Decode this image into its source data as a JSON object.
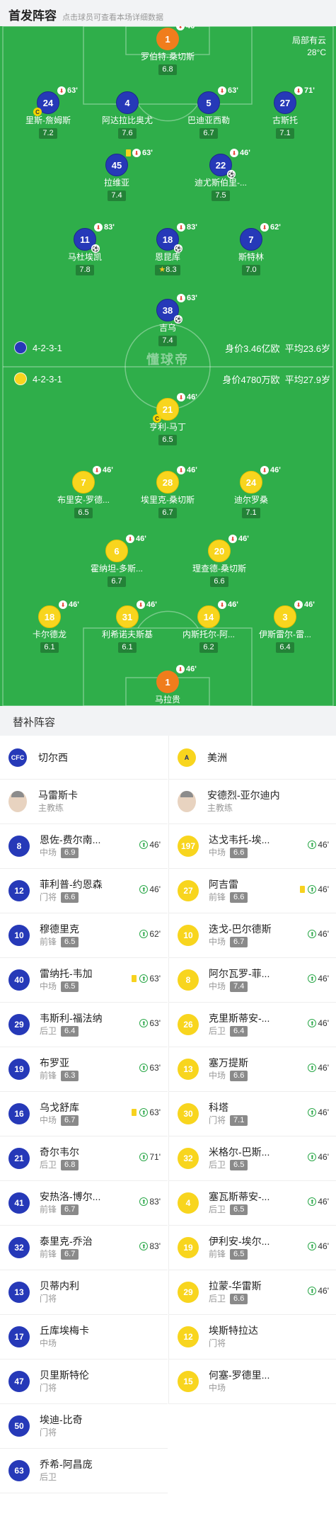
{
  "header": {
    "title": "首发阵容",
    "subtitle": "点击球员可查看本场详细数据"
  },
  "weather": {
    "condition": "局部有云",
    "temperature": "28°C"
  },
  "watermark": "懂球帝",
  "home_team": {
    "name": "切尔西",
    "formation": "4-2-3-1",
    "value": "身价3.46亿欧",
    "avg_age": "平均23.6岁",
    "color": "#2639b8"
  },
  "away_team": {
    "name": "美洲",
    "formation": "4-2-3-1",
    "value": "身价4780万欧",
    "avg_age": "平均27.9岁",
    "color": "#f8d51e"
  },
  "home_players": [
    {
      "num": "1",
      "name": "罗伯特-桑切斯",
      "rating": "6.8",
      "sub_min": "46'",
      "gk": true
    },
    {
      "num": "24",
      "name": "里斯-詹姆斯",
      "rating": "7.2",
      "sub_min": "63'",
      "captain": true
    },
    {
      "num": "4",
      "name": "阿达拉比奥尤",
      "rating": "7.6"
    },
    {
      "num": "5",
      "name": "巴迪亚西勒",
      "rating": "6.7",
      "sub_min": "63'"
    },
    {
      "num": "27",
      "name": "古斯托",
      "rating": "7.1",
      "sub_min": "71'"
    },
    {
      "num": "45",
      "name": "拉维亚",
      "rating": "7.4",
      "sub_min": "63'",
      "yellow": true
    },
    {
      "num": "22",
      "name": "迪尤斯伯里-...",
      "rating": "7.5",
      "sub_min": "46'",
      "goal": true
    },
    {
      "num": "11",
      "name": "马杜埃凯",
      "rating": "7.8",
      "sub_min": "83'",
      "goal": true
    },
    {
      "num": "18",
      "name": "恩昆库",
      "rating": "8.3",
      "sub_min": "83'",
      "goal": true,
      "best": true
    },
    {
      "num": "7",
      "name": "斯特林",
      "rating": "7.0",
      "sub_min": "62'"
    },
    {
      "num": "38",
      "name": "吉乌",
      "rating": "7.4",
      "sub_min": "63'",
      "goal": true
    }
  ],
  "away_players": [
    {
      "num": "21",
      "name": "亨利-马丁",
      "rating": "6.5",
      "sub_min": "46'",
      "captain": true
    },
    {
      "num": "7",
      "name": "布里安-罗德...",
      "rating": "6.5",
      "sub_min": "46'"
    },
    {
      "num": "28",
      "name": "埃里克-桑切斯",
      "rating": "6.7",
      "sub_min": "46'"
    },
    {
      "num": "24",
      "name": "迪尔罗桑",
      "rating": "7.1",
      "sub_min": "46'"
    },
    {
      "num": "6",
      "name": "霍纳坦-多斯...",
      "rating": "6.7",
      "sub_min": "46'"
    },
    {
      "num": "20",
      "name": "理查德-桑切斯",
      "rating": "6.6",
      "sub_min": "46'"
    },
    {
      "num": "18",
      "name": "卡尔德龙",
      "rating": "6.1",
      "sub_min": "46'"
    },
    {
      "num": "31",
      "name": "利希诺夫斯基",
      "rating": "6.1",
      "sub_min": "46'"
    },
    {
      "num": "14",
      "name": "内斯托尔-阿...",
      "rating": "6.2",
      "sub_min": "46'"
    },
    {
      "num": "3",
      "name": "伊斯雷尔-雷...",
      "rating": "6.4",
      "sub_min": "46'"
    },
    {
      "num": "1",
      "name": "马拉贵",
      "rating": "7.2",
      "sub_min": "46'",
      "gk": true
    }
  ],
  "subs_title": "替补阵容",
  "home_coach": {
    "name": "马雷斯卡",
    "role": "主教练"
  },
  "away_coach": {
    "name": "安德烈-亚尔迪内",
    "role": "主教练"
  },
  "home_subs": [
    {
      "num": "8",
      "name": "恩佐-费尔南...",
      "pos": "中场",
      "rating": "6.9",
      "min": "46'"
    },
    {
      "num": "12",
      "name": "菲利普-约恩森",
      "pos": "门将",
      "rating": "6.6",
      "min": "46'"
    },
    {
      "num": "10",
      "name": "穆德里克",
      "pos": "前锋",
      "rating": "6.5",
      "min": "62'"
    },
    {
      "num": "40",
      "name": "雷纳托-韦加",
      "pos": "中场",
      "rating": "6.5",
      "min": "63'",
      "yellow": true
    },
    {
      "num": "29",
      "name": "韦斯利-福法纳",
      "pos": "后卫",
      "rating": "6.4",
      "min": "63'"
    },
    {
      "num": "19",
      "name": "布罗亚",
      "pos": "前锋",
      "rating": "6.3",
      "min": "63'"
    },
    {
      "num": "16",
      "name": "乌戈舒库",
      "pos": "中场",
      "rating": "6.7",
      "min": "63'",
      "yellow": true
    },
    {
      "num": "21",
      "name": "奇尔韦尔",
      "pos": "后卫",
      "rating": "6.8",
      "min": "71'"
    },
    {
      "num": "41",
      "name": "安热洛-博尔...",
      "pos": "前锋",
      "rating": "6.7",
      "min": "83'"
    },
    {
      "num": "32",
      "name": "泰里克-乔治",
      "pos": "前锋",
      "rating": "6.7",
      "min": "83'"
    },
    {
      "num": "13",
      "name": "贝蒂内利",
      "pos": "门将"
    },
    {
      "num": "17",
      "name": "丘库埃梅卡",
      "pos": "中场"
    },
    {
      "num": "47",
      "name": "贝里斯特伦",
      "pos": "门将"
    },
    {
      "num": "50",
      "name": "埃迪-比奇",
      "pos": "门将"
    },
    {
      "num": "63",
      "name": "乔希-阿昌庞",
      "pos": "后卫"
    }
  ],
  "away_subs": [
    {
      "num": "197",
      "name": "达戈韦托-埃...",
      "pos": "中场",
      "rating": "6.6",
      "min": "46'"
    },
    {
      "num": "27",
      "name": "阿吉雷",
      "pos": "前锋",
      "rating": "6.6",
      "min": "46'",
      "yellow": true
    },
    {
      "num": "10",
      "name": "迭戈-巴尔德斯",
      "pos": "中场",
      "rating": "6.7",
      "min": "46'"
    },
    {
      "num": "8",
      "name": "阿尔瓦罗-菲...",
      "pos": "中场",
      "rating": "7.4",
      "min": "46'"
    },
    {
      "num": "26",
      "name": "克里斯蒂安-...",
      "pos": "后卫",
      "rating": "6.4",
      "min": "46'"
    },
    {
      "num": "13",
      "name": "塞万提斯",
      "pos": "中场",
      "rating": "6.6",
      "min": "46'"
    },
    {
      "num": "30",
      "name": "科塔",
      "pos": "门将",
      "rating": "7.1",
      "min": "46'"
    },
    {
      "num": "32",
      "name": "米格尔-巴斯...",
      "pos": "后卫",
      "rating": "6.5",
      "min": "46'"
    },
    {
      "num": "4",
      "name": "塞瓦斯蒂安-...",
      "pos": "后卫",
      "rating": "6.5",
      "min": "46'"
    },
    {
      "num": "19",
      "name": "伊利安-埃尔...",
      "pos": "前锋",
      "rating": "6.5",
      "min": "46'"
    },
    {
      "num": "29",
      "name": "拉蒙-华雷斯",
      "pos": "后卫",
      "rating": "6.6",
      "min": "46'"
    },
    {
      "num": "12",
      "name": "埃斯特拉达",
      "pos": "门将"
    },
    {
      "num": "15",
      "name": "何塞-罗德里...",
      "pos": "中场"
    }
  ]
}
